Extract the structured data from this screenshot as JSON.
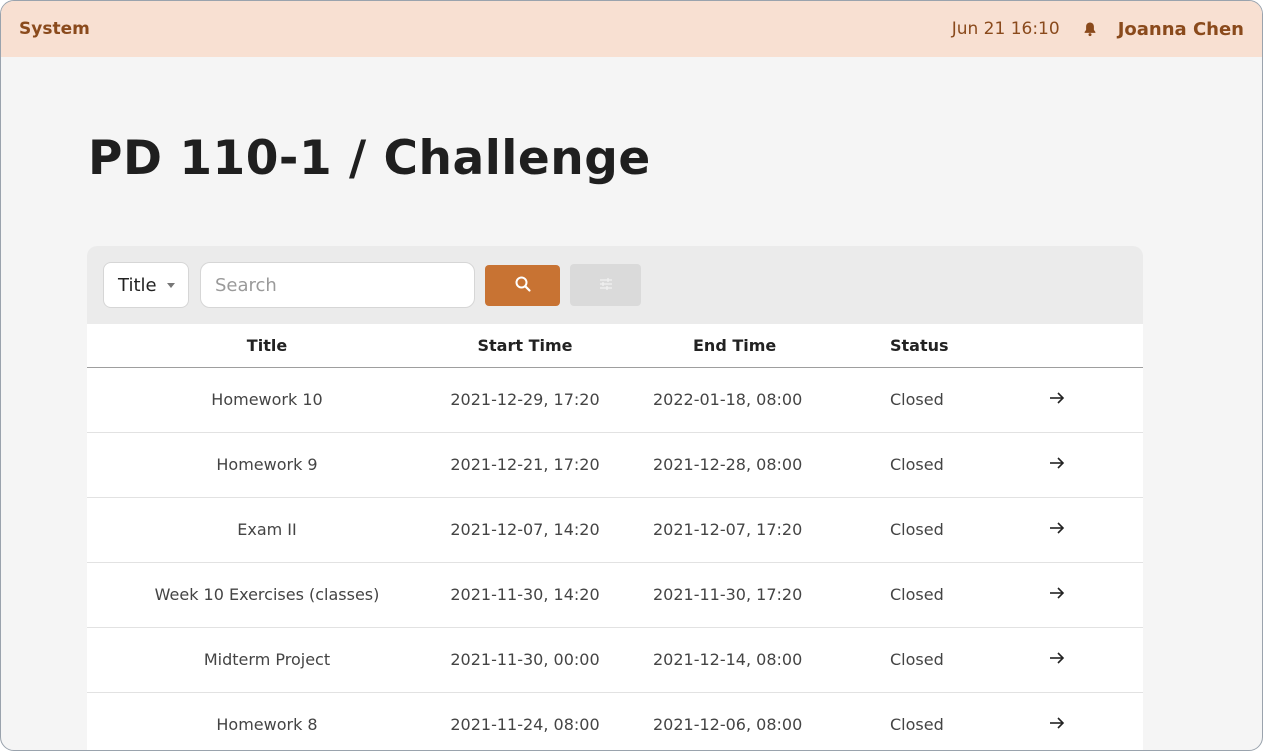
{
  "topbar": {
    "brand": "System",
    "datetime": "Jun 21 16:10",
    "user": "Joanna Chen",
    "bell_icon": "bell-icon",
    "accent": "#8a4a1c",
    "background": "#f8e0d2"
  },
  "page": {
    "title": "PD 110-1 / Challenge"
  },
  "toolbar": {
    "filter_select": "Title",
    "search_placeholder": "Search",
    "search_icon": "search-icon",
    "filter_icon": "sliders-icon",
    "search_button_color": "#c87333"
  },
  "table": {
    "headers": {
      "title": "Title",
      "start": "Start Time",
      "end": "End Time",
      "status": "Status"
    },
    "rows": [
      {
        "title": "Homework 10",
        "start": "2021-12-29, 17:20",
        "end": "2022-01-18, 08:00",
        "status": "Closed"
      },
      {
        "title": "Homework 9",
        "start": "2021-12-21, 17:20",
        "end": "2021-12-28, 08:00",
        "status": "Closed"
      },
      {
        "title": "Exam II",
        "start": "2021-12-07, 14:20",
        "end": "2021-12-07, 17:20",
        "status": "Closed"
      },
      {
        "title": "Week 10 Exercises (classes)",
        "start": "2021-11-30, 14:20",
        "end": "2021-11-30, 17:20",
        "status": "Closed"
      },
      {
        "title": "Midterm Project",
        "start": "2021-11-30, 00:00",
        "end": "2021-12-14, 08:00",
        "status": "Closed"
      },
      {
        "title": "Homework 8",
        "start": "2021-11-24, 08:00",
        "end": "2021-12-06, 08:00",
        "status": "Closed"
      }
    ],
    "row_action_icon": "arrow-right-icon"
  }
}
